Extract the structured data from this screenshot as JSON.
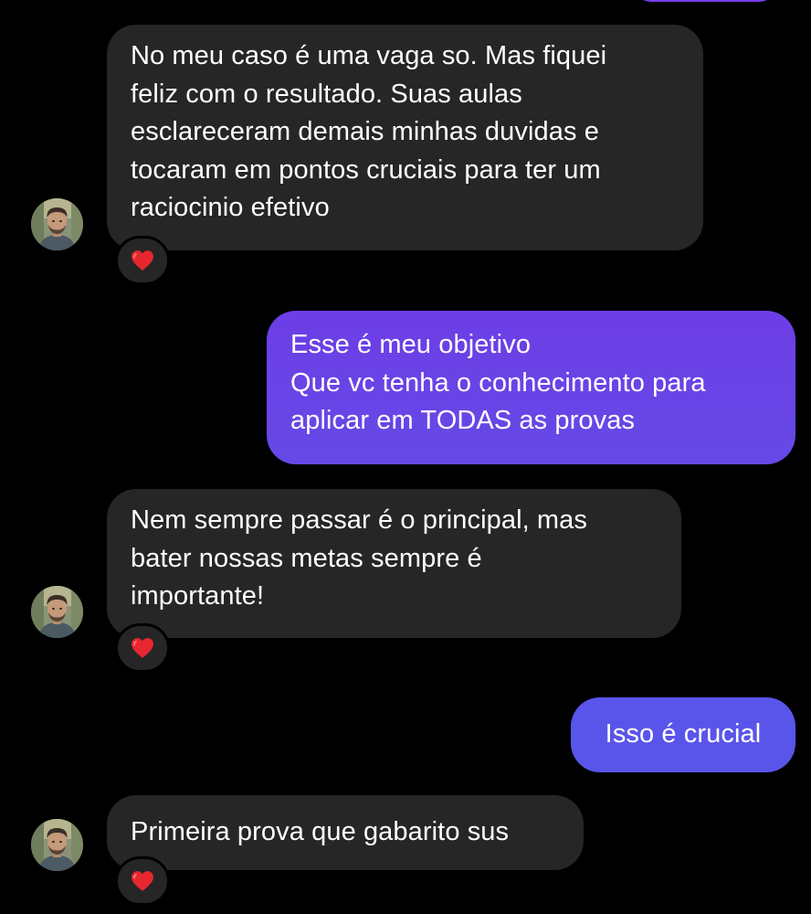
{
  "conversation": {
    "messages": [
      {
        "direction": "incoming",
        "lines": [
          "No meu caso é uma vaga so. Mas fiquei",
          "feliz com o resultado. Suas aulas",
          "esclareceram demais minhas duvidas e",
          "tocaram em pontos cruciais para ter um",
          "raciocinio efetivo"
        ],
        "reaction": "heart-icon"
      },
      {
        "direction": "outgoing",
        "lines": [
          "Esse é meu objetivo",
          "Que vc tenha o conhecimento para",
          "aplicar em TODAS as provas"
        ]
      },
      {
        "direction": "incoming",
        "lines": [
          "Nem sempre passar é o principal, mas",
          "bater nossas metas sempre é",
          "importante!"
        ],
        "reaction": "heart-icon"
      },
      {
        "direction": "outgoing",
        "lines": [
          "Isso é crucial"
        ]
      },
      {
        "direction": "incoming",
        "lines": [
          "Primeira prova que gabarito sus"
        ],
        "reaction": "heart-icon"
      }
    ]
  },
  "colors": {
    "background": "#000000",
    "incoming_bubble": "#262626",
    "outgoing_bubble_top": "#6d3ee6",
    "outgoing_bubble_short": "#5a55ea",
    "text": "#ffffff",
    "heart": "#e8262f"
  }
}
